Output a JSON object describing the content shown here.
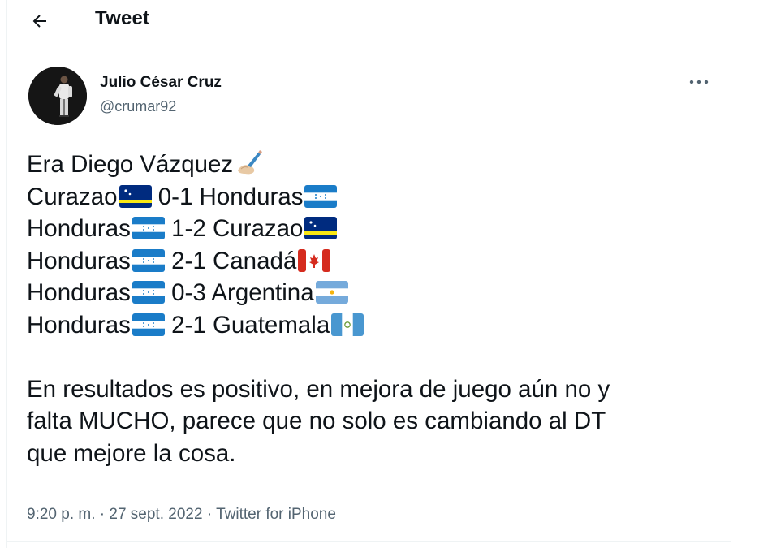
{
  "header": {
    "title": "Tweet",
    "back_icon": "arrow-left-icon"
  },
  "author": {
    "name": "Julio César Cruz",
    "handle": "@crumar92"
  },
  "tweet": {
    "line1": "Era Diego Vázquez",
    "results": [
      {
        "home": "Curazao",
        "home_flag": "curacao-flag",
        "score": " 0-1 ",
        "away": "Honduras",
        "away_flag": "honduras-flag"
      },
      {
        "home": "Honduras",
        "home_flag": "honduras-flag",
        "score": " 1-2 ",
        "away": "Curazao",
        "away_flag": "curacao-flag"
      },
      {
        "home": "Honduras",
        "home_flag": "honduras-flag",
        "score": " 2-1 ",
        "away": "Canadá",
        "away_flag": "canada-flag"
      },
      {
        "home": "Honduras",
        "home_flag": "honduras-flag",
        "score": " 0-3 ",
        "away": "Argentina",
        "away_flag": "argentina-flag"
      },
      {
        "home": "Honduras",
        "home_flag": "honduras-flag",
        "score": " 2-1 ",
        "away": "Guatemala",
        "away_flag": "guatemala-flag"
      }
    ],
    "paragraph_lines": [
      "En resultados es positivo, en mejora de juego aún no y",
      "falta MUCHO, parece que no solo es cambiando al DT",
      "que mejore la cosa."
    ]
  },
  "meta": {
    "time": "9:20 p. m.",
    "separator": " · ",
    "date": "27 sept. 2022",
    "source": "Twitter for iPhone"
  },
  "colors": {
    "text": "#0f1419",
    "secondary": "#536471",
    "divider": "#eff3f4"
  }
}
